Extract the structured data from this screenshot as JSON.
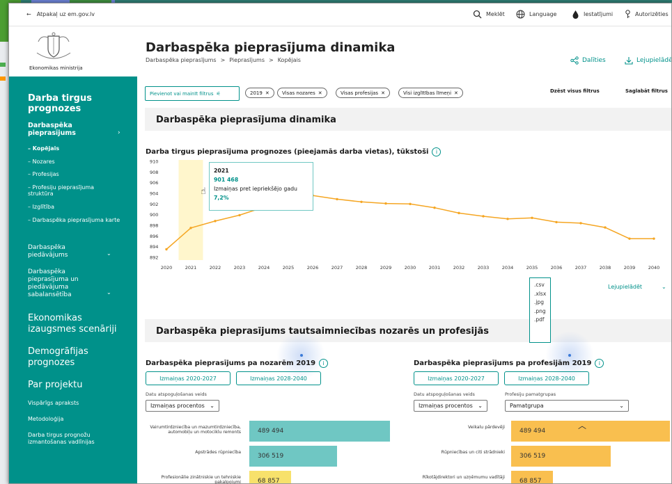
{
  "topbar": {
    "back_label": "Atpakaļ uz em.gov.lv",
    "search_label": "Meklēt",
    "language_label": "Language",
    "settings_label": "Iestatījumi",
    "login_label": "Autorizēties"
  },
  "sidebar": {
    "ministry": "Ekonomikas ministrija",
    "section_title": "Darba tirgus prognozes",
    "group_demand": "Darbaspēka pieprasījums",
    "items": [
      {
        "label": "– Kopējais"
      },
      {
        "label": "– Nozares"
      },
      {
        "label": "– Profesijas"
      },
      {
        "label": "– Profesiju pieprasījuma struktūra"
      },
      {
        "label": "– Izglītība"
      },
      {
        "label": "– Darbaspēka pieprasījuma karte"
      }
    ],
    "group_supply": "Darbaspēka piedāvājums",
    "group_balance": "Darbaspēka pieprasījuma un piedāvājuma sabalansētība",
    "scenarios": "Ekonomikas izaugsmes scenāriji",
    "demography": "Demogrāfijas prognozes",
    "about": "Par projektu",
    "about_links": [
      "Vispārīgs apraksts",
      "Metodoloģija",
      "Darba tirgus prognožu izmantošanas vadlīnijas"
    ]
  },
  "page": {
    "title": "Darbaspēka pieprasījuma dinamika",
    "breadcrumb": [
      "Darbaspēka pieprasījums",
      ">",
      "Pieprasījums",
      ">",
      "Kopējais"
    ],
    "share_label": "Dalīties",
    "download_label": "Lejupielādēt"
  },
  "filters": {
    "add_label": "Pievienot vai mainīt filtrus",
    "chips": [
      "2019",
      "Visas nozares",
      "Visas profesijas",
      "Visi izglītības līmeņi"
    ],
    "clear_label": "Dzēst visus filtrus",
    "save_label": "Saglabāt filtrus"
  },
  "section1": {
    "title": "Darbaspēka pieprasījuma dinamika",
    "chart_title": "Darba tirgus pieprasījuma prognozes (pieejamās darba vietas), tūkstoši",
    "tooltip": {
      "year": "2021",
      "value": "901 468",
      "label": "Izmaiņas pret iepriekšējo gadu",
      "change": "7,2%"
    },
    "download_label": "Lejupielādēt",
    "download_options": [
      ".csv",
      ".xlsx",
      ".jpg",
      ".png",
      ".pdf"
    ]
  },
  "section2": {
    "title": "Darbaspēka pieprasījums tautsaimniecības nozarēs un profesijās",
    "left": {
      "title": "Darbaspēka pieprasījums pa nozarēm 2019",
      "btn1": "Izmaiņas 2020-2027",
      "btn2": "Izmaiņas 2028-2040",
      "mode_label": "Datu atspoguļošanas veids",
      "mode_value": "Izmaiņas procentos"
    },
    "right": {
      "title": "Darbaspēka pieprasījums pa profesijām 2019",
      "btn1": "Izmaiņas 2020-2027",
      "btn2": "Izmaiņas 2028-2040",
      "mode_label": "Datu atspoguļošanas veids",
      "mode_value": "Izmaiņas procentos",
      "group_label": "Profesiju pamatgrupas",
      "group_value": "Pamatgrupa"
    }
  },
  "colors": {
    "teal": "#00918a",
    "orange": "#f5a623",
    "bar_teal": "#6fc7c3",
    "bar_orange": "#f9bf4f",
    "bar_yellow": "#f7e16b"
  },
  "chart_data": [
    {
      "type": "line",
      "title": "Darba tirgus pieprasījuma prognozes (pieejamās darba vietas), tūkstoši",
      "x": [
        2020,
        2021,
        2022,
        2023,
        2024,
        2025,
        2026,
        2027,
        2028,
        2029,
        2030,
        2031,
        2032,
        2033,
        2034,
        2035,
        2036,
        2037,
        2038,
        2039,
        2040
      ],
      "series": [
        {
          "values": [
            893.5,
            897.5,
            898.8,
            899.9,
            901.4,
            902.8,
            903.6,
            902.9,
            902.4,
            902.1,
            902.0,
            901.3,
            900.3,
            899.7,
            899.2,
            899.4,
            898.6,
            898.4,
            897.6,
            895.5,
            895.5
          ]
        }
      ],
      "ylim": [
        892,
        910
      ],
      "yticks": [
        892,
        894,
        896,
        898,
        900,
        902,
        904,
        906,
        908,
        910
      ],
      "highlight_year": 2021
    },
    {
      "type": "bar",
      "categories": [
        "Vairumtirdzniecība un mazumtirdzniecība, automobiļu un motociklu remonts",
        "Apstrādes rūpniecība",
        "Profesionālie zinātniskie un tehniskie pakalpojumi"
      ],
      "values": [
        489494,
        306519,
        68857
      ],
      "labels": [
        "489 494",
        "306 519",
        "68 857"
      ]
    },
    {
      "type": "bar",
      "categories": [
        "Veikalu pārdevēji",
        "Rūpniecības un citi strādnieki",
        "Rīkotājdirektori un uzņēmumu vadītāji"
      ],
      "values": [
        489494,
        306519,
        68857
      ],
      "labels": [
        "489 494",
        "306 519",
        "68 857"
      ]
    }
  ]
}
